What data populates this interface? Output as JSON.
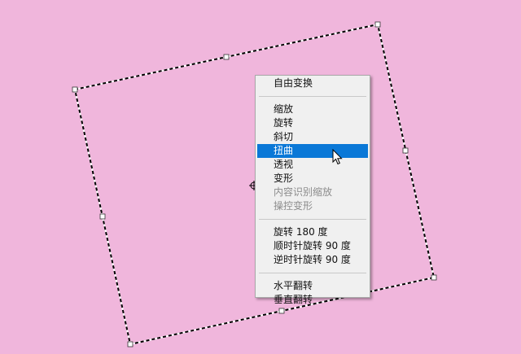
{
  "canvas": {
    "background": "#f0b6dc"
  },
  "context_menu": {
    "groups": [
      [
        {
          "label": "自由变换",
          "state": "normal"
        }
      ],
      [
        {
          "label": "缩放",
          "state": "normal"
        },
        {
          "label": "旋转",
          "state": "normal"
        },
        {
          "label": "斜切",
          "state": "normal"
        },
        {
          "label": "扭曲",
          "state": "highlighted"
        },
        {
          "label": "透视",
          "state": "normal"
        },
        {
          "label": "变形",
          "state": "normal"
        },
        {
          "label": "内容识别缩放",
          "state": "disabled"
        },
        {
          "label": "操控变形",
          "state": "disabled"
        }
      ],
      [
        {
          "label": "旋转 180 度",
          "state": "normal"
        },
        {
          "label": "顺时针旋转 90 度",
          "state": "normal"
        },
        {
          "label": "逆时针旋转 90 度",
          "state": "normal"
        }
      ],
      [
        {
          "label": "水平翻转",
          "state": "normal"
        },
        {
          "label": "垂直翻转",
          "state": "normal"
        }
      ]
    ],
    "highlight_color": "#0a78d7"
  },
  "icons": {
    "pointer": "arrow-cursor-icon",
    "center": "transform-center-icon"
  }
}
